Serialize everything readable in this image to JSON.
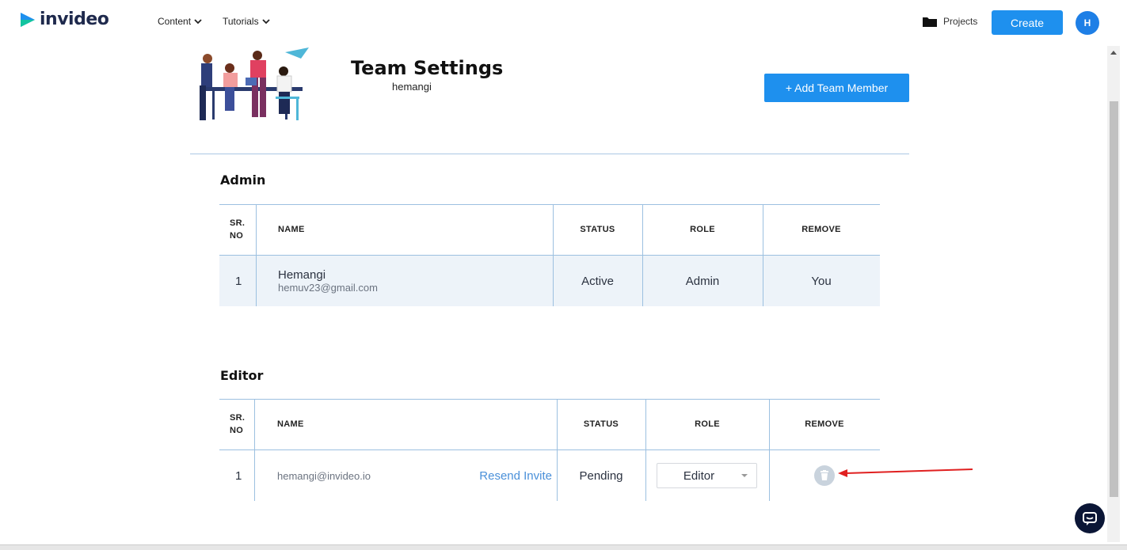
{
  "brand": {
    "name": "invideo"
  },
  "nav": {
    "content": "Content",
    "tutorials": "Tutorials"
  },
  "topbar": {
    "projects": "Projects",
    "create": "Create",
    "avatar_initial": "H"
  },
  "page": {
    "title": "Team Settings",
    "subtitle": "hemangi",
    "add_member": "+ Add Team Member"
  },
  "admin": {
    "title": "Admin",
    "headers": {
      "sr": "SR.",
      "no": "NO",
      "name": "NAME",
      "status": "STATUS",
      "role": "ROLE",
      "remove": "REMOVE"
    },
    "rows": [
      {
        "sr": "1",
        "name": "Hemangi",
        "email": "hemuv23@gmail.com",
        "status": "Active",
        "role": "Admin",
        "remove": "You"
      }
    ]
  },
  "editor": {
    "title": "Editor",
    "headers": {
      "sr": "SR.",
      "no": "NO",
      "name": "NAME",
      "status": "STATUS",
      "role": "ROLE",
      "remove": "REMOVE"
    },
    "rows": [
      {
        "sr": "1",
        "email": "hemangi@invideo.io",
        "resend": "Resend Invite",
        "status": "Pending",
        "role": "Editor"
      }
    ]
  },
  "colors": {
    "accent": "#1e90ee",
    "row_bg": "#edf3f9",
    "border": "#9cc0e0",
    "annotation": "#e02020"
  },
  "icons": [
    "play-logo-icon",
    "chevron-down-icon",
    "folder-icon",
    "trash-icon",
    "chat-icon",
    "caret-down-icon"
  ]
}
